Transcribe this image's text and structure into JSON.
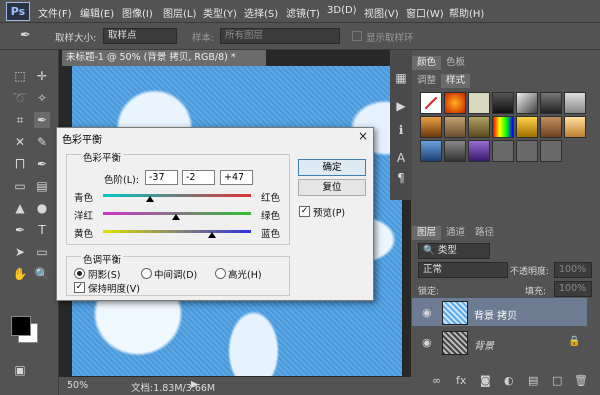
{
  "menu": {
    "logo": "Ps",
    "items": [
      "文件(F)",
      "编辑(E)",
      "图像(I)",
      "图层(L)",
      "类型(Y)",
      "选择(S)",
      "滤镜(T)",
      "3D(D)",
      "视图(V)",
      "窗口(W)",
      "帮助(H)"
    ]
  },
  "options": {
    "sample_size_label": "取样大小:",
    "sample_size_value": "取样点",
    "sample_label": "样本:",
    "sample_value": "所有图层",
    "show_ring_label": "显示取样环"
  },
  "document": {
    "tab_title": "未标题-1 @ 50% (背景 拷贝, RGB/8) *",
    "zoom": "50%",
    "doc_info": "文档:1.83M/3.66M"
  },
  "panels": {
    "color_tabs": [
      "颜色",
      "色板"
    ],
    "adjust_tabs": [
      "调整",
      "样式"
    ],
    "layers_tabs": [
      "图层",
      "通道",
      "路径"
    ],
    "kind_filter": "类型",
    "blend_mode": "正常",
    "opacity_label": "不透明度:",
    "opacity_value": "100%",
    "lock_label": "锁定:",
    "fill_label": "填充:",
    "fill_value": "100%",
    "layers": [
      {
        "name": "背景 拷贝"
      },
      {
        "name": "背景"
      }
    ]
  },
  "dialog": {
    "title": "色彩平衡",
    "close": "×",
    "group1_title": "色彩平衡",
    "levels_label": "色阶(L):",
    "levels": [
      "-37",
      "-2",
      "+47"
    ],
    "sliders": [
      {
        "left": "青色",
        "right": "红色",
        "value": -37
      },
      {
        "left": "洋红",
        "right": "绿色",
        "value": -2
      },
      {
        "left": "黄色",
        "right": "蓝色",
        "value": 47
      }
    ],
    "group2_title": "色调平衡",
    "tones": [
      "阴影(S)",
      "中间调(D)",
      "高光(H)"
    ],
    "preserve_label": "保持明度(V)",
    "ok": "确定",
    "reset": "复位",
    "preview": "预览(P)"
  }
}
